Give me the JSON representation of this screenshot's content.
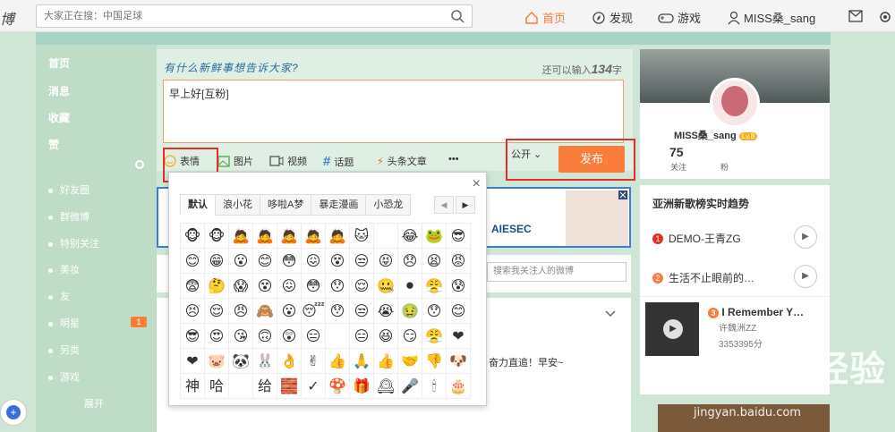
{
  "header": {
    "logo": "博",
    "search_placeholder": "大家正在搜：中国足球",
    "nav": [
      {
        "label": "首页",
        "icon": "home-icon"
      },
      {
        "label": "发现",
        "icon": "compass-icon"
      },
      {
        "label": "游戏",
        "icon": "gamepad-icon"
      },
      {
        "label": "MISS桑_sang",
        "icon": "user-icon"
      }
    ]
  },
  "sidebar": {
    "items": [
      "首页",
      "消息",
      "收藏",
      "赞"
    ],
    "groups": [
      "好友圈",
      "群微博",
      "特别关注"
    ],
    "subitems": [
      "美妆",
      "友",
      "明星",
      "另类",
      "游戏"
    ],
    "badge": "1",
    "expand": "展开"
  },
  "composer": {
    "prompt": "有什么新鲜事想告诉大家?",
    "remain_label": "还可以输入",
    "remain_count": "134",
    "remain_unit": "字",
    "text": "早上好[互粉]",
    "tools": [
      "表情",
      "图片",
      "视频",
      "话题",
      "头条文章",
      "•••"
    ],
    "visibility": "公开",
    "publish": "发布"
  },
  "emoji_panel": {
    "tabs": [
      "默认",
      "浪小花",
      "哆啦A梦",
      "暴走漫画",
      "小恐龙"
    ],
    "active_tab": "默认",
    "emojis": [
      "🐵",
      "🐵",
      "🙇",
      "🙇",
      "🙇",
      "🙇",
      "🙇",
      "🐱",
      "",
      "😂",
      "🐸",
      "😎",
      "😊",
      "😁",
      "😮",
      "😊",
      "😳",
      "😖",
      "😵",
      "😒",
      "😝",
      "😞",
      "😫",
      "😡",
      "😨",
      "🤔",
      "😱",
      "😵",
      "😖",
      "😳",
      "😯",
      "😌",
      "🤐",
      "⚫",
      "😤",
      "😰",
      "😣",
      "😌",
      "😠",
      "🙈",
      "😮",
      "😴",
      "😯",
      "😒",
      "😭",
      "🤢",
      "😯",
      "😊",
      "😎",
      "😍",
      "😘",
      "🙃",
      "😲",
      "😑",
      "",
      "😑",
      "😆",
      "😏",
      "😤",
      "❤",
      "❤",
      "🐷",
      "🐼",
      "🐰",
      "👌",
      "✌",
      "👍",
      "🙏",
      "👍",
      "🤝",
      "👎",
      "🐶",
      "神",
      "哈",
      "",
      "给",
      "🧱",
      "✓",
      "🍄",
      "🎁",
      "🕰",
      "🎤",
      "🕯",
      "🎂"
    ]
  },
  "ad": {
    "text": "AIESEC"
  },
  "feed": {
    "search_placeholder": "搜索我关注人的微博",
    "snippet": "奋力直追！早安~"
  },
  "profile": {
    "name": "MISS桑_sang",
    "level": "Lv.8",
    "follow_count": "75",
    "follow_label": "关注",
    "fans_label": "粉"
  },
  "trends": {
    "title": "亚洲新歌榜实时趋势",
    "items": [
      {
        "rank": "1",
        "title": "DEMO-王青ZG"
      },
      {
        "rank": "2",
        "title": "生活不止眼前的…"
      }
    ]
  },
  "music": {
    "rank": "3",
    "title": "I Remember Y…",
    "artist": "许魏洲ZZ",
    "plays": "3353395分"
  },
  "watermark": {
    "main": "Bai百 经验",
    "sub": "jingyan.baidu.com"
  }
}
